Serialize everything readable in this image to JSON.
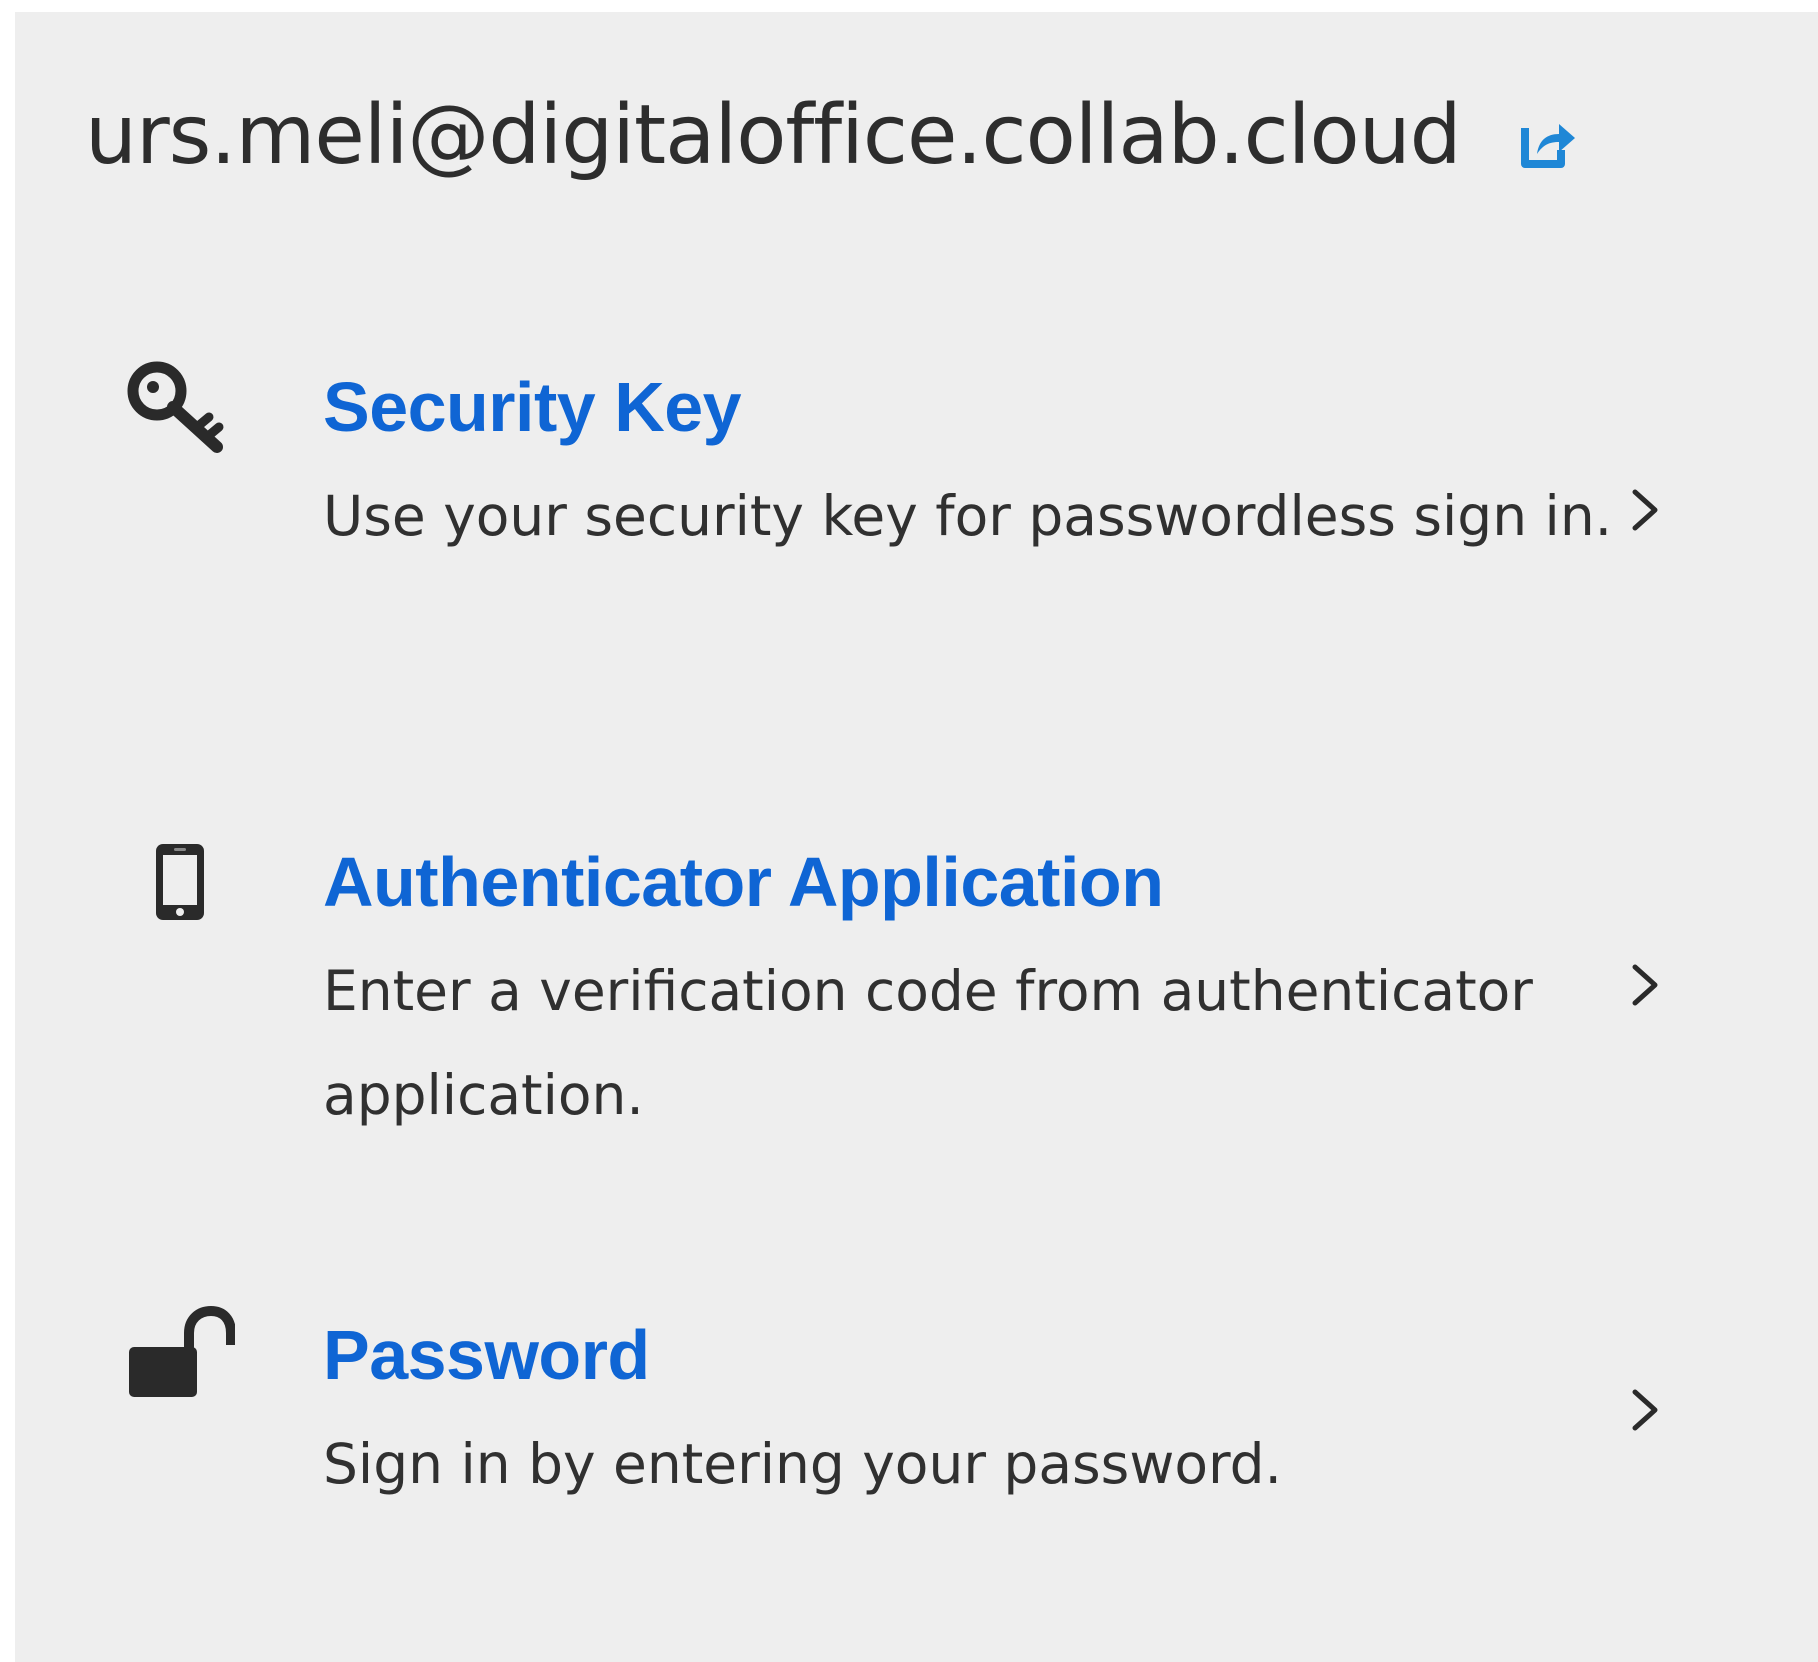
{
  "header": {
    "username": "urs.meli@digitaloffice.collab.cloud",
    "restart_icon": "external-link-icon"
  },
  "options": [
    {
      "title": "Security Key",
      "description": "Use your security key for passwordless sign in.",
      "icon": "key-icon"
    },
    {
      "title": "Authenticator Application",
      "description": "Enter a verification code from authenticator application.",
      "icon": "mobile-phone-icon"
    },
    {
      "title": "Password",
      "description": "Sign in by entering your password.",
      "icon": "unlock-icon"
    }
  ],
  "colors": {
    "background": "#eeeeee",
    "title_blue": "#0f65d4",
    "text": "#303030",
    "icon_link": "#1f87d6"
  }
}
